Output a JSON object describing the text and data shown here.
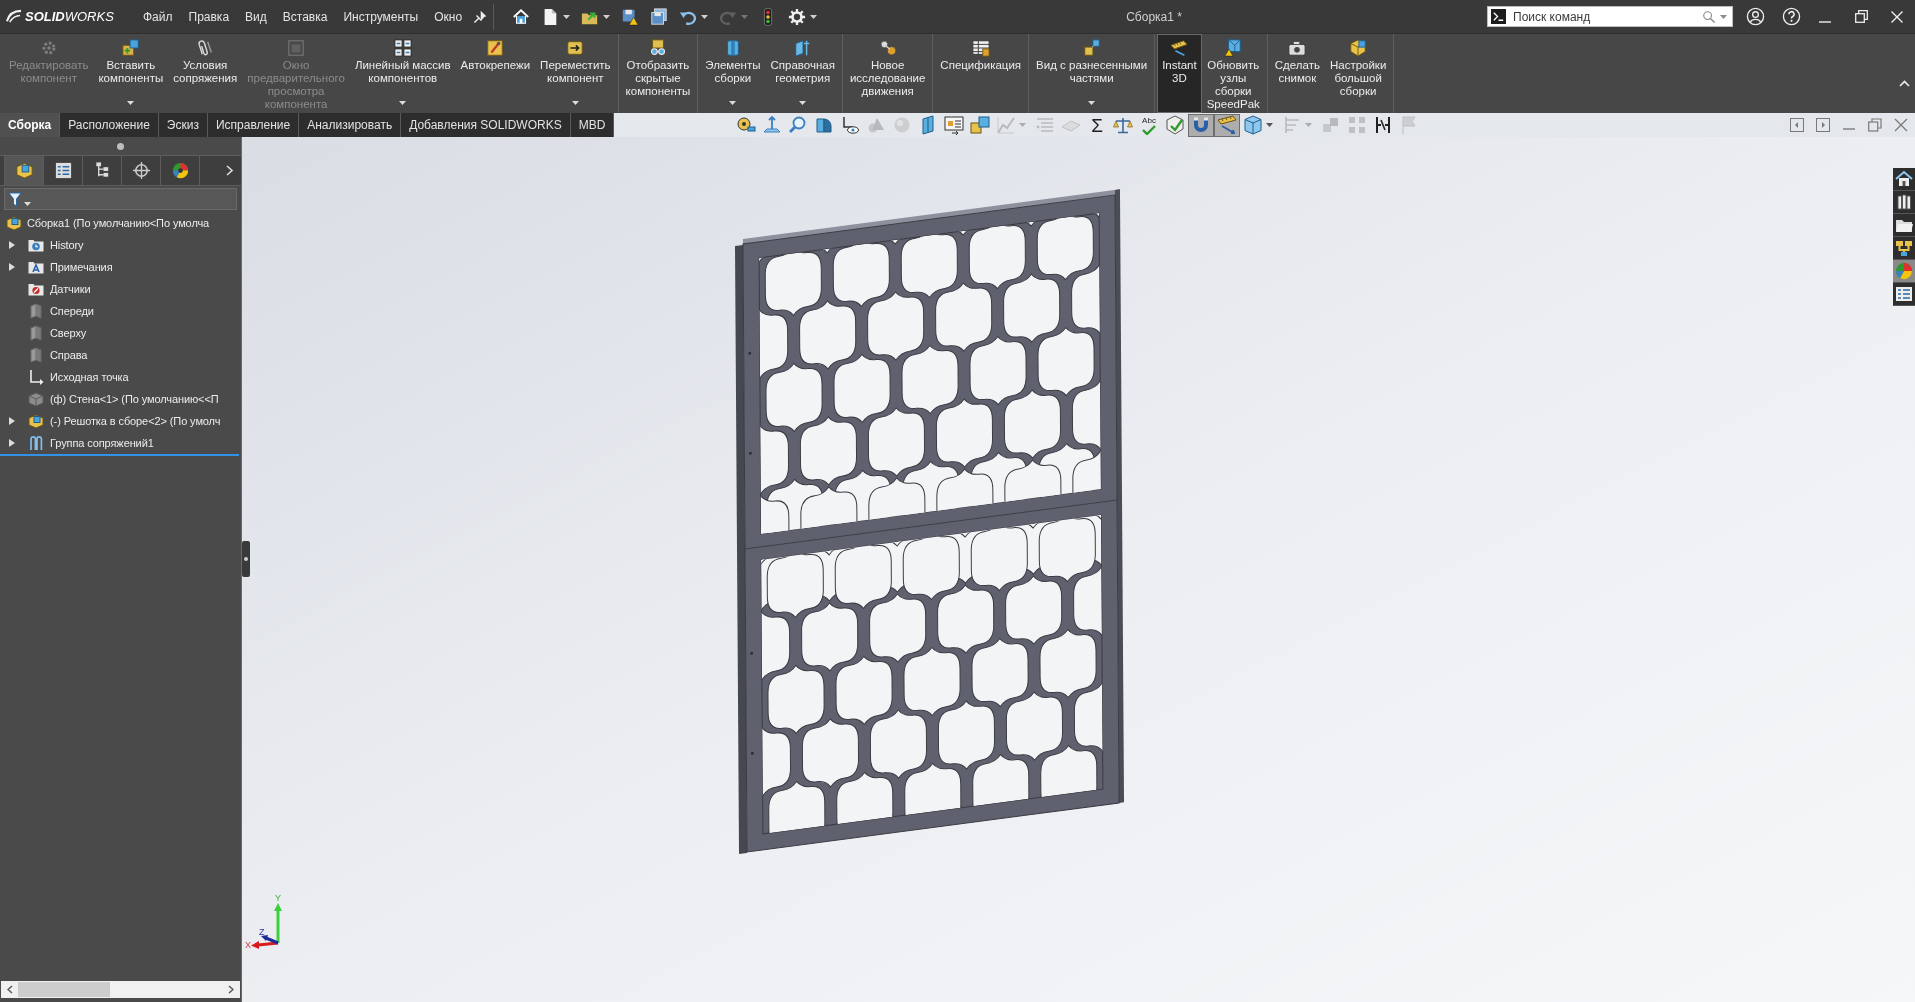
{
  "title_bar": {
    "logo": "**SOLID**WORKS",
    "menu": [
      "Файл",
      "Правка",
      "Вид",
      "Вставка",
      "Инструменты",
      "Окно"
    ],
    "quick_access": [
      {
        "disabled": false,
        "dropdown": false
      },
      {
        "disabled": false,
        "dropdown": true
      },
      {
        "disabled": false,
        "dropdown": true
      },
      {
        "disabled": false,
        "dropdown": false
      },
      {
        "disabled": false,
        "dropdown": false
      },
      {
        "disabled": false,
        "dropdown": true
      },
      {
        "disabled": true,
        "dropdown": true
      },
      {
        "disabled": false,
        "dropdown": false
      },
      {
        "disabled": false,
        "dropdown": true
      }
    ],
    "document_title": "Сборка1 *",
    "search": {
      "placeholder": "Поиск команд"
    }
  },
  "ribbon": {
    "groups": [
      {
        "items": [
          {
            "label": "Редактировать\nкомпонент",
            "disabled": true,
            "dropdown": false,
            "selected": false
          },
          {
            "label": "Вставить\nкомпоненты",
            "disabled": false,
            "dropdown": true,
            "selected": false
          },
          {
            "label": "Условия\nсопряжения",
            "disabled": false,
            "dropdown": false,
            "selected": false
          },
          {
            "label": "Окно\nпредварительного\nпросмотра\nкомпонента",
            "disabled": true,
            "dropdown": false,
            "selected": false
          },
          {
            "label": "Линейный массив\nкомпонентов",
            "disabled": false,
            "dropdown": true,
            "selected": false
          },
          {
            "label": "Автокрепежи",
            "disabled": false,
            "dropdown": false,
            "selected": false
          },
          {
            "label": "Переместить\nкомпонент",
            "disabled": false,
            "dropdown": true,
            "selected": false
          }
        ]
      },
      {
        "items": [
          {
            "label": "Отобразить\nскрытые\nкомпоненты",
            "disabled": false,
            "dropdown": false,
            "selected": false
          }
        ]
      },
      {
        "items": [
          {
            "label": "Элементы\nсборки",
            "disabled": false,
            "dropdown": true,
            "selected": false
          },
          {
            "label": "Справочная\nгеометрия",
            "disabled": false,
            "dropdown": true,
            "selected": false
          }
        ]
      },
      {
        "items": [
          {
            "label": "Новое\nисследование\nдвижения",
            "disabled": false,
            "dropdown": false,
            "selected": false
          }
        ]
      },
      {
        "items": [
          {
            "label": "Спецификация",
            "disabled": false,
            "dropdown": false,
            "selected": false
          }
        ]
      },
      {
        "items": [
          {
            "label": "Вид с разнесенными\nчастями",
            "disabled": false,
            "dropdown": true,
            "selected": false
          }
        ]
      },
      {
        "items": [
          {
            "label": "Instant\n3D",
            "disabled": false,
            "dropdown": false,
            "selected": true
          },
          {
            "label": "Обновить\nузлы\nсборки\nSpeedPak",
            "disabled": false,
            "dropdown": false,
            "selected": false
          }
        ]
      },
      {
        "items": [
          {
            "label": "Сделать\nснимок",
            "disabled": false,
            "dropdown": false,
            "selected": false
          },
          {
            "label": "Настройки\nбольшой\nсборки",
            "disabled": false,
            "dropdown": false,
            "selected": false
          }
        ]
      }
    ]
  },
  "command_tabs": [
    {
      "label": "Сборка",
      "selected": true
    },
    {
      "label": "Расположение",
      "selected": false
    },
    {
      "label": "Эскиз",
      "selected": false
    },
    {
      "label": "Исправление",
      "selected": false
    },
    {
      "label": "Анализировать",
      "selected": false
    },
    {
      "label": "Добавления SOLIDWORKS",
      "selected": false
    },
    {
      "label": "MBD",
      "selected": false
    }
  ],
  "view_toolbar": [
    {
      "kind": "icon",
      "disabled": false,
      "selected": false,
      "dropdown": false
    },
    {
      "kind": "icon",
      "disabled": false,
      "selected": false,
      "dropdown": false
    },
    {
      "kind": "icon",
      "disabled": false,
      "selected": false,
      "dropdown": false
    },
    {
      "kind": "icon",
      "disabled": false,
      "selected": false,
      "dropdown": false
    },
    {
      "kind": "icon",
      "disabled": false,
      "selected": false,
      "dropdown": false
    },
    {
      "kind": "icon",
      "disabled": true,
      "selected": false,
      "dropdown": false
    },
    {
      "kind": "icon",
      "disabled": true,
      "selected": false,
      "dropdown": false
    },
    {
      "kind": "icon",
      "disabled": false,
      "selected": false,
      "dropdown": false
    },
    {
      "kind": "icon",
      "disabled": false,
      "selected": false,
      "dropdown": false
    },
    {
      "kind": "icon",
      "disabled": false,
      "selected": false,
      "dropdown": false
    },
    {
      "kind": "icon",
      "disabled": true,
      "selected": false,
      "dropdown": true
    },
    {
      "kind": "icon",
      "disabled": true,
      "selected": false,
      "dropdown": false
    },
    {
      "kind": "icon",
      "disabled": true,
      "selected": false,
      "dropdown": false
    },
    {
      "kind": "glyph",
      "glyph": "Σ",
      "disabled": false,
      "selected": false,
      "dropdown": false
    },
    {
      "kind": "icon",
      "disabled": false,
      "selected": false,
      "dropdown": false
    },
    {
      "kind": "spellcheck",
      "glyph": "Abc",
      "disabled": false,
      "selected": false,
      "dropdown": false
    },
    {
      "kind": "icon",
      "disabled": false,
      "selected": false,
      "dropdown": false
    },
    {
      "kind": "icon",
      "disabled": false,
      "selected": true,
      "dropdown": false
    },
    {
      "kind": "icon",
      "disabled": false,
      "selected": true,
      "dropdown": false
    },
    {
      "kind": "icon",
      "disabled": false,
      "selected": false,
      "dropdown": true
    },
    {
      "kind": "icon",
      "disabled": true,
      "selected": false,
      "dropdown": true
    },
    {
      "kind": "icon",
      "disabled": true,
      "selected": false,
      "dropdown": false
    },
    {
      "kind": "icon",
      "disabled": true,
      "selected": false,
      "dropdown": false
    },
    {
      "kind": "icon",
      "disabled": false,
      "selected": false,
      "dropdown": false
    },
    {
      "kind": "icon",
      "disabled": true,
      "selected": false,
      "dropdown": false
    }
  ],
  "panel_tabs": [
    {
      "selected": true
    },
    {
      "selected": false
    },
    {
      "selected": false
    },
    {
      "selected": false
    },
    {
      "selected": false
    }
  ],
  "feature_tree": {
    "root": {
      "label": "Сборка1 (По умолчанию<По умолча",
      "kind": "assembly"
    },
    "children": [
      {
        "label": "History",
        "kind": "history",
        "expanded": false
      },
      {
        "label": "Примечания",
        "kind": "annotations",
        "expanded": false
      },
      {
        "label": "Датчики",
        "kind": "sensors"
      },
      {
        "label": "Спереди",
        "kind": "plane"
      },
      {
        "label": "Сверху",
        "kind": "plane"
      },
      {
        "label": "Справа",
        "kind": "plane"
      },
      {
        "label": "Исходная точка",
        "kind": "origin"
      },
      {
        "label": "(ф) Стена<1> (По умолчанию<<П",
        "kind": "part"
      },
      {
        "label": "(-) Решотка в сборе<2> (По умолч",
        "kind": "assembly",
        "expanded": false
      },
      {
        "label": "Группа сопряжений1",
        "kind": "mates",
        "expanded": false
      }
    ]
  },
  "task_pane": [
    {
      "selected": false
    },
    {
      "selected": false
    },
    {
      "selected": false
    },
    {
      "selected": false
    },
    {
      "selected": true
    },
    {
      "selected": false
    }
  ],
  "triad": {
    "x": "X",
    "y": "Y",
    "z": "Z"
  }
}
